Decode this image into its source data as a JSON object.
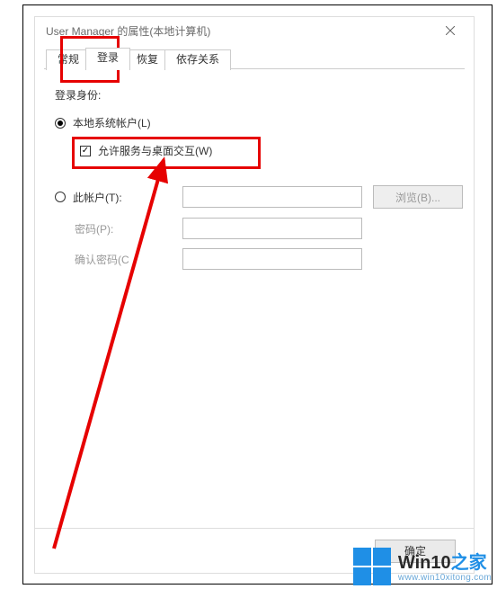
{
  "window": {
    "title": "User Manager 的属性(本地计算机)"
  },
  "tabs": {
    "t0": "常规",
    "t1": "登录",
    "t2": "恢复",
    "t3": "依存关系",
    "active": "登录"
  },
  "form": {
    "section": "登录身份:",
    "local_system": "本地系统帐户(L)",
    "allow_desktop": "允许服务与桌面交互(W)",
    "this_account": "此帐户(T):",
    "browse": "浏览(B)...",
    "password": "密码(P):",
    "confirm_password": "确认密码(C",
    "this_account_value": "",
    "password_value": "",
    "confirm_value": ""
  },
  "buttons": {
    "ok": "确定"
  },
  "watermark": {
    "brand_a": "Win10",
    "brand_b": "之家",
    "url": "www.win10xitong.com"
  }
}
